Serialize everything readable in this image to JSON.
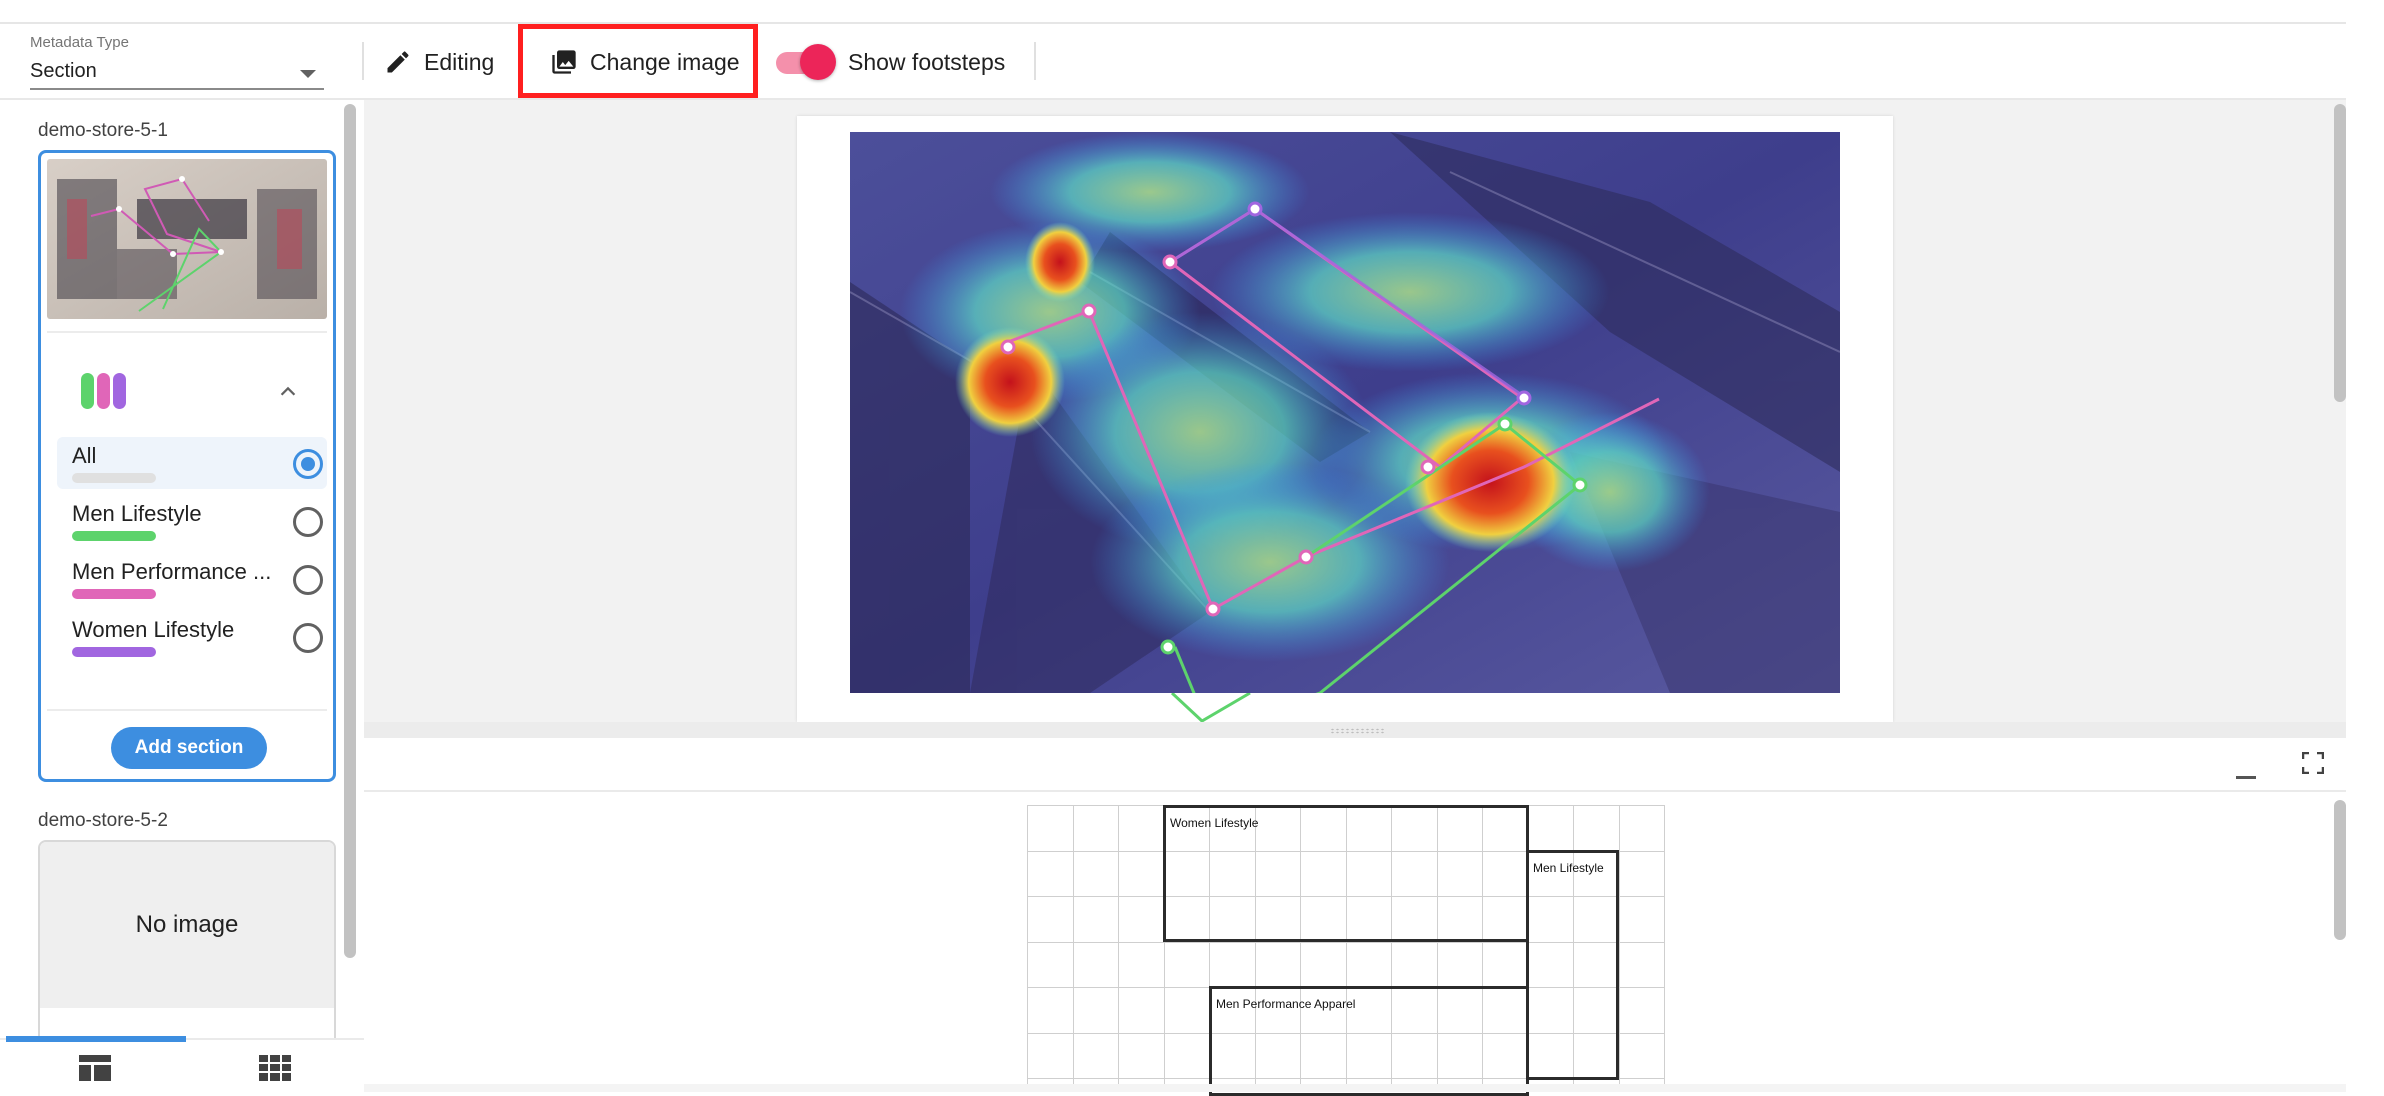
{
  "toolbar": {
    "metadata_type_label": "Metadata Type",
    "metadata_type_value": "Section",
    "editing_label": "Editing",
    "change_image_label": "Change image",
    "show_footsteps_label": "Show footsteps",
    "show_footsteps_on": true
  },
  "stores": [
    {
      "name": "demo-store-5-1",
      "sections": [
        {
          "label": "All",
          "color": "#e0e0e0",
          "selected": true
        },
        {
          "label": "Men Lifestyle",
          "color": "#5dd36c",
          "selected": false
        },
        {
          "label": "Men Performance ...",
          "color": "#e066b8",
          "selected": false
        },
        {
          "label": "Women Lifestyle",
          "color": "#a166e0",
          "selected": false
        }
      ],
      "add_section_label": "Add section"
    },
    {
      "name": "demo-store-5-2",
      "no_image_label": "No image"
    }
  ],
  "floorplan": {
    "zones": [
      {
        "label": "Women Lifestyle"
      },
      {
        "label": "Men Lifestyle"
      },
      {
        "label": "Men Performance Apparel"
      }
    ]
  },
  "colors": {
    "accent": "#3d8ee0",
    "toggle": "#ec2559",
    "highlight_border": "#ff1f1f"
  },
  "icons": [
    "pencil-icon",
    "image-icon",
    "chevron-up-icon",
    "minimize-icon",
    "fullscreen-icon",
    "list-view-icon",
    "grid-view-icon"
  ]
}
